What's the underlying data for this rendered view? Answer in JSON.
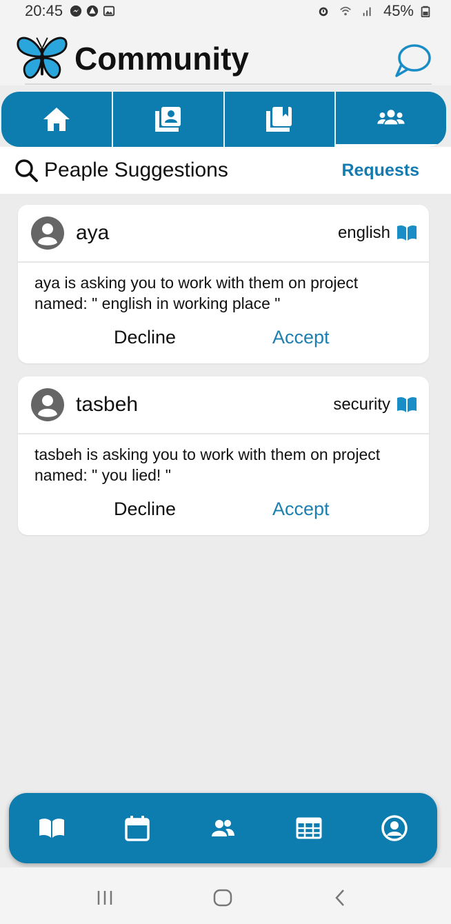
{
  "status_bar": {
    "time": "20:45",
    "battery": "45%",
    "left_icons": [
      "messenger-icon",
      "app-icon",
      "image-icon"
    ],
    "right_icons": [
      "alarm-icon",
      "wifi-icon",
      "signal-icon",
      "battery-icon"
    ]
  },
  "header": {
    "title": "Community",
    "logo": "butterfly-logo",
    "chat_icon": "chat-bubble-icon"
  },
  "tabs": [
    {
      "icon": "home-icon",
      "active": false
    },
    {
      "icon": "contacts-book-icon",
      "active": false
    },
    {
      "icon": "bookmark-book-icon",
      "active": false
    },
    {
      "icon": "people-group-icon",
      "active": true
    }
  ],
  "subheader": {
    "title": "Peaple Suggestions",
    "requests_link": "Requests"
  },
  "requests": [
    {
      "name": "aya",
      "topic": "english",
      "message_line1": "aya is asking you to work with them on project",
      "message_line2": "named: \" english in working place \"",
      "decline": "Decline",
      "accept": "Accept"
    },
    {
      "name": "tasbeh",
      "topic": "security",
      "message_line1": "tasbeh is asking you to work with them on project",
      "message_line2": "named: \" you lied! \"",
      "decline": "Decline",
      "accept": "Accept"
    }
  ],
  "bottom_nav": [
    "open-book-icon",
    "calendar-icon",
    "people-icon",
    "table-icon",
    "user-circle-icon"
  ],
  "colors": {
    "brand": "#0d7db0",
    "accept": "#1d7fb0",
    "requests_link": "#137bb0",
    "background": "#ececec"
  }
}
